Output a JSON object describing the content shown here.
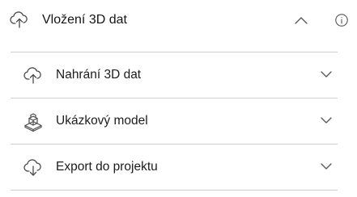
{
  "header": {
    "title": "Vložení 3D dat",
    "icon": "cloud-upload-icon",
    "collapse_icon": "chevron-up-icon",
    "info_icon": "info-icon"
  },
  "sections": [
    {
      "label": "Nahrání 3D dat",
      "icon": "cloud-upload-icon",
      "expanded": false
    },
    {
      "label": "Ukázkový model",
      "icon": "model-icon",
      "expanded": false
    },
    {
      "label": "Export do projektu",
      "icon": "cloud-download-icon",
      "expanded": false
    }
  ],
  "colors": {
    "text": "#151515",
    "icon": "#4a4a4a",
    "divider": "#cfcfcf",
    "background": "#ffffff"
  }
}
